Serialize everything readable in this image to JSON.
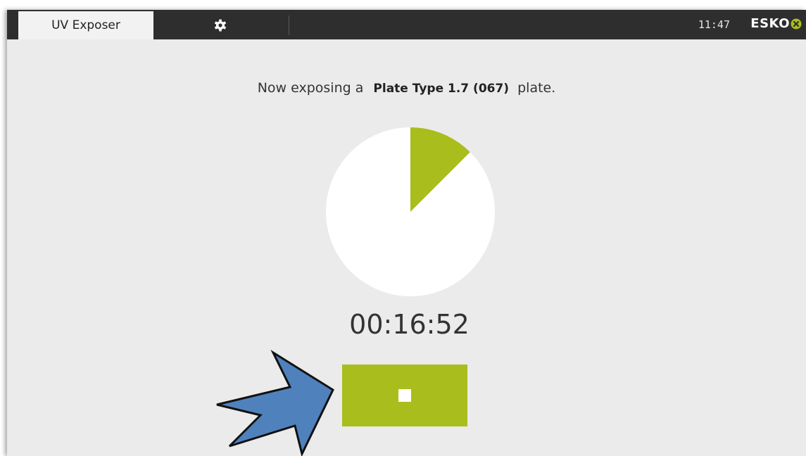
{
  "header": {
    "tab_label": "UV Exposer",
    "settings_icon": "gear-icon",
    "time": "11:47",
    "logo_text": "ESKO"
  },
  "exposure": {
    "message_prefix": "Now exposing a",
    "plate_type": "Plate Type 1.7 (067)",
    "message_suffix": "plate.",
    "progress_fraction": 0.125,
    "timer": "00:16:52"
  },
  "controls": {
    "stop_icon": "stop-icon"
  },
  "annotation": {
    "arrow_icon": "pointer-arrow-icon"
  },
  "colors": {
    "accent": "#a9bd1c",
    "topbar": "#2e2e2e",
    "background": "#ebebeb",
    "arrow_fill": "#4f81bd"
  }
}
